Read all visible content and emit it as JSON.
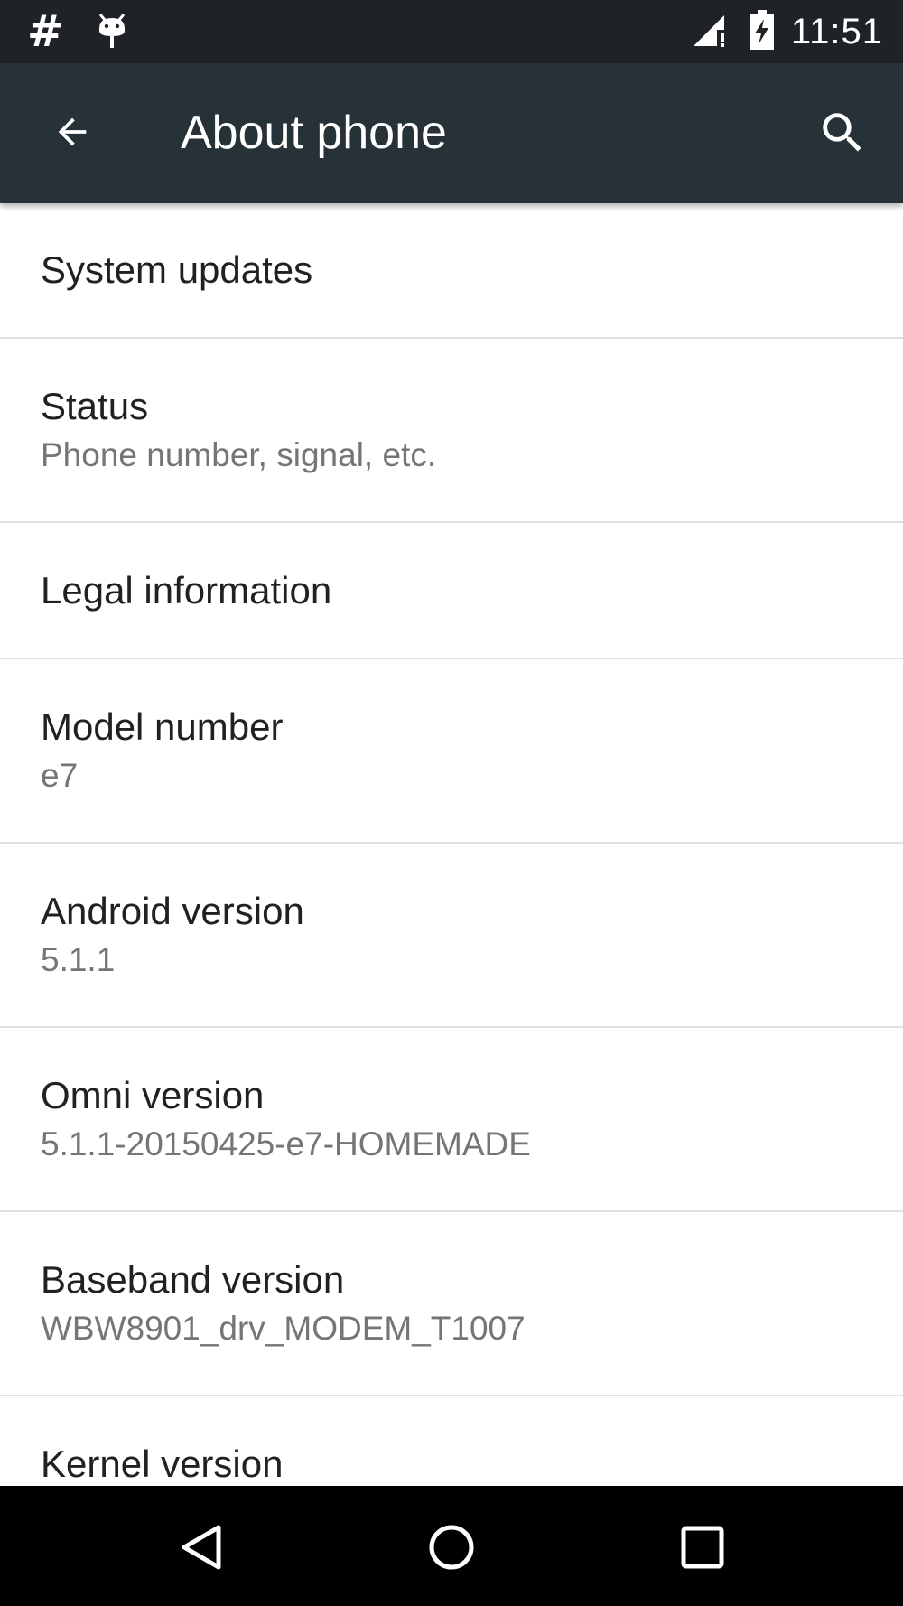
{
  "status_bar": {
    "left_icons": [
      "hash-icon",
      "android-debug-icon"
    ],
    "hash_glyph": "#",
    "right_icons": [
      "signal-icon",
      "battery-charging-icon"
    ],
    "time": "11:51"
  },
  "app_bar": {
    "title": "About phone",
    "back_icon": "arrow-back-icon",
    "search_icon": "search-icon",
    "background_color": "#263238"
  },
  "settings_list": {
    "items": [
      {
        "title": "System updates"
      },
      {
        "title": "Status",
        "summary": "Phone number, signal, etc."
      },
      {
        "title": "Legal information"
      },
      {
        "title": "Model number",
        "summary": "e7"
      },
      {
        "title": "Android version",
        "summary": "5.1.1"
      },
      {
        "title": "Omni version",
        "summary": "5.1.1-20150425-e7-HOMEMADE"
      },
      {
        "title": "Baseband version",
        "summary": "WBW8901_drv_MODEM_T1007"
      },
      {
        "title": "Kernel version"
      }
    ]
  },
  "nav_bar": {
    "buttons": [
      "back-triangle-icon",
      "home-circle-icon",
      "recents-square-icon"
    ]
  }
}
